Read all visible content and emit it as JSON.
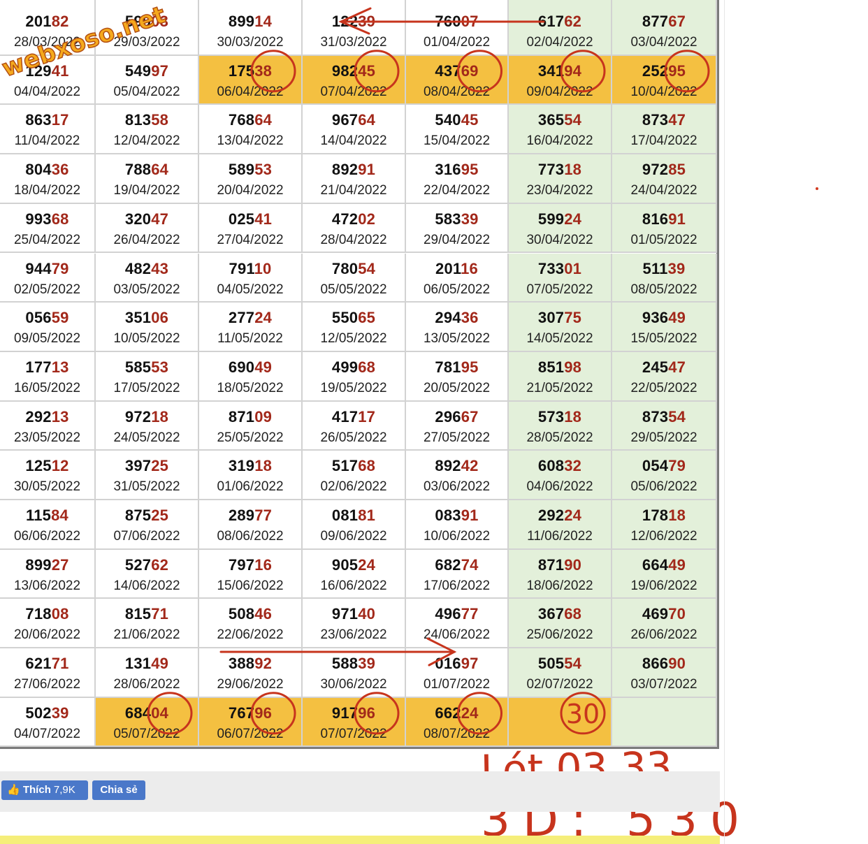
{
  "watermark": "webxoso.net",
  "rows": [
    [
      {
        "n": "20182",
        "d": "28/03/2022"
      },
      {
        "n": "59903",
        "d": "29/03/2022"
      },
      {
        "n": "89914",
        "d": "30/03/2022"
      },
      {
        "n": "12239",
        "d": "31/03/2022"
      },
      {
        "n": "76007",
        "d": "01/04/2022"
      },
      {
        "n": "61762",
        "d": "02/04/2022"
      },
      {
        "n": "87767",
        "d": "03/04/2022"
      }
    ],
    [
      {
        "n": "12941",
        "d": "04/04/2022"
      },
      {
        "n": "54997",
        "d": "05/04/2022"
      },
      {
        "n": "17538",
        "d": "06/04/2022",
        "hl": true,
        "circle": true
      },
      {
        "n": "98245",
        "d": "07/04/2022",
        "hl": true,
        "circle": true
      },
      {
        "n": "43769",
        "d": "08/04/2022",
        "hl": true,
        "circle": true
      },
      {
        "n": "34194",
        "d": "09/04/2022",
        "hl": true,
        "circle": true
      },
      {
        "n": "25295",
        "d": "10/04/2022",
        "hl": true,
        "circle": true
      }
    ],
    [
      {
        "n": "86317",
        "d": "11/04/2022"
      },
      {
        "n": "81358",
        "d": "12/04/2022"
      },
      {
        "n": "76864",
        "d": "13/04/2022"
      },
      {
        "n": "96764",
        "d": "14/04/2022"
      },
      {
        "n": "54045",
        "d": "15/04/2022"
      },
      {
        "n": "36554",
        "d": "16/04/2022"
      },
      {
        "n": "87347",
        "d": "17/04/2022"
      }
    ],
    [
      {
        "n": "80436",
        "d": "18/04/2022"
      },
      {
        "n": "78864",
        "d": "19/04/2022"
      },
      {
        "n": "58953",
        "d": "20/04/2022"
      },
      {
        "n": "89291",
        "d": "21/04/2022"
      },
      {
        "n": "31695",
        "d": "22/04/2022"
      },
      {
        "n": "77318",
        "d": "23/04/2022"
      },
      {
        "n": "97285",
        "d": "24/04/2022"
      }
    ],
    [
      {
        "n": "99368",
        "d": "25/04/2022"
      },
      {
        "n": "32047",
        "d": "26/04/2022"
      },
      {
        "n": "02541",
        "d": "27/04/2022"
      },
      {
        "n": "47202",
        "d": "28/04/2022"
      },
      {
        "n": "58339",
        "d": "29/04/2022"
      },
      {
        "n": "59924",
        "d": "30/04/2022"
      },
      {
        "n": "81691",
        "d": "01/05/2022"
      }
    ],
    [
      {
        "n": "94479",
        "d": "02/05/2022"
      },
      {
        "n": "48243",
        "d": "03/05/2022"
      },
      {
        "n": "79110",
        "d": "04/05/2022"
      },
      {
        "n": "78054",
        "d": "05/05/2022"
      },
      {
        "n": "20116",
        "d": "06/05/2022"
      },
      {
        "n": "73301",
        "d": "07/05/2022"
      },
      {
        "n": "51139",
        "d": "08/05/2022"
      }
    ],
    [
      {
        "n": "05659",
        "d": "09/05/2022"
      },
      {
        "n": "35106",
        "d": "10/05/2022"
      },
      {
        "n": "27724",
        "d": "11/05/2022"
      },
      {
        "n": "55065",
        "d": "12/05/2022"
      },
      {
        "n": "29436",
        "d": "13/05/2022"
      },
      {
        "n": "30775",
        "d": "14/05/2022"
      },
      {
        "n": "93649",
        "d": "15/05/2022"
      }
    ],
    [
      {
        "n": "17713",
        "d": "16/05/2022"
      },
      {
        "n": "58553",
        "d": "17/05/2022"
      },
      {
        "n": "69049",
        "d": "18/05/2022"
      },
      {
        "n": "49968",
        "d": "19/05/2022"
      },
      {
        "n": "78195",
        "d": "20/05/2022"
      },
      {
        "n": "85198",
        "d": "21/05/2022"
      },
      {
        "n": "24547",
        "d": "22/05/2022"
      }
    ],
    [
      {
        "n": "29213",
        "d": "23/05/2022"
      },
      {
        "n": "97218",
        "d": "24/05/2022"
      },
      {
        "n": "87109",
        "d": "25/05/2022"
      },
      {
        "n": "41717",
        "d": "26/05/2022"
      },
      {
        "n": "29667",
        "d": "27/05/2022"
      },
      {
        "n": "57318",
        "d": "28/05/2022"
      },
      {
        "n": "87354",
        "d": "29/05/2022"
      }
    ],
    [
      {
        "n": "12512",
        "d": "30/05/2022"
      },
      {
        "n": "39725",
        "d": "31/05/2022"
      },
      {
        "n": "31918",
        "d": "01/06/2022"
      },
      {
        "n": "51768",
        "d": "02/06/2022"
      },
      {
        "n": "89242",
        "d": "03/06/2022"
      },
      {
        "n": "60832",
        "d": "04/06/2022"
      },
      {
        "n": "05479",
        "d": "05/06/2022"
      }
    ],
    [
      {
        "n": "11584",
        "d": "06/06/2022"
      },
      {
        "n": "87525",
        "d": "07/06/2022"
      },
      {
        "n": "28977",
        "d": "08/06/2022"
      },
      {
        "n": "08181",
        "d": "09/06/2022"
      },
      {
        "n": "08391",
        "d": "10/06/2022"
      },
      {
        "n": "29224",
        "d": "11/06/2022"
      },
      {
        "n": "17818",
        "d": "12/06/2022"
      }
    ],
    [
      {
        "n": "89927",
        "d": "13/06/2022"
      },
      {
        "n": "52762",
        "d": "14/06/2022"
      },
      {
        "n": "79716",
        "d": "15/06/2022"
      },
      {
        "n": "90524",
        "d": "16/06/2022"
      },
      {
        "n": "68274",
        "d": "17/06/2022"
      },
      {
        "n": "87190",
        "d": "18/06/2022"
      },
      {
        "n": "66449",
        "d": "19/06/2022"
      }
    ],
    [
      {
        "n": "71808",
        "d": "20/06/2022"
      },
      {
        "n": "81571",
        "d": "21/06/2022"
      },
      {
        "n": "50846",
        "d": "22/06/2022"
      },
      {
        "n": "97140",
        "d": "23/06/2022"
      },
      {
        "n": "49677",
        "d": "24/06/2022"
      },
      {
        "n": "36768",
        "d": "25/06/2022"
      },
      {
        "n": "46970",
        "d": "26/06/2022"
      }
    ],
    [
      {
        "n": "62171",
        "d": "27/06/2022"
      },
      {
        "n": "13149",
        "d": "28/06/2022"
      },
      {
        "n": "38892",
        "d": "29/06/2022"
      },
      {
        "n": "58839",
        "d": "30/06/2022"
      },
      {
        "n": "01697",
        "d": "01/07/2022"
      },
      {
        "n": "50554",
        "d": "02/07/2022"
      },
      {
        "n": "86690",
        "d": "03/07/2022"
      }
    ],
    [
      {
        "n": "50239",
        "d": "04/07/2022"
      },
      {
        "n": "68404",
        "d": "05/07/2022",
        "hl": true,
        "circle": true
      },
      {
        "n": "76796",
        "d": "06/07/2022",
        "hl": true,
        "circle": true
      },
      {
        "n": "91796",
        "d": "07/07/2022",
        "hl": true,
        "circle": true
      },
      {
        "n": "66224",
        "d": "08/07/2022",
        "hl": true,
        "circle": true
      },
      {
        "n": "",
        "d": "",
        "hl": true,
        "circle": true,
        "mark": "30"
      },
      {
        "n": "",
        "d": ""
      }
    ]
  ],
  "annotations": {
    "line1": "Lót 03,33",
    "line2": "3D: 530"
  },
  "social": {
    "like_label": "Thích",
    "like_count": "7,9K",
    "share_label": "Chia sẻ"
  },
  "colors": {
    "tail": "#a2281a",
    "highlight": "#f4c041",
    "weekend": "#e3f0da",
    "ink": "#c7341d",
    "fb": "#4a78c9"
  }
}
